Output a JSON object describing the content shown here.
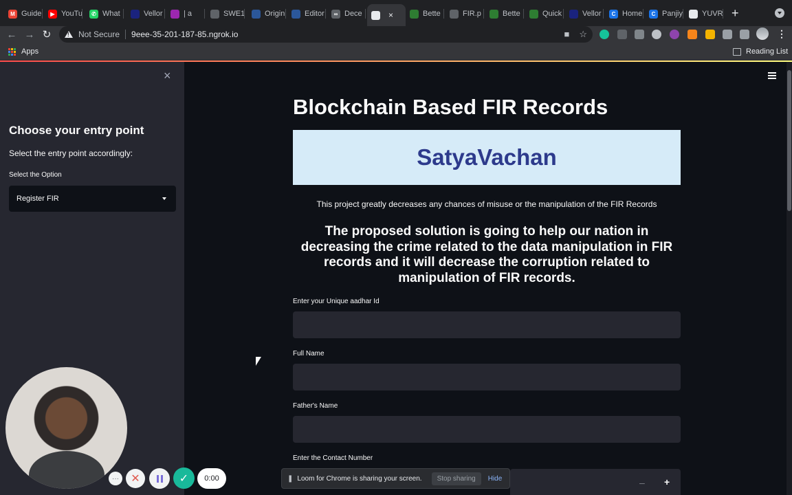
{
  "browser": {
    "tabs": [
      {
        "label": "Guide",
        "fav": "M",
        "color": "#ea4335"
      },
      {
        "label": "YouTu",
        "fav": "▶",
        "color": "#ff0000"
      },
      {
        "label": "What",
        "fav": "✆",
        "color": "#25d366"
      },
      {
        "label": "Vellor",
        "fav": "",
        "color": "#1a237e"
      },
      {
        "label": "| a",
        "fav": "",
        "color": "#9c27b0"
      },
      {
        "label": "SWE1",
        "fav": "",
        "color": "#5f6368"
      },
      {
        "label": "Origin",
        "fav": "",
        "color": "#2b579a"
      },
      {
        "label": "Editor",
        "fav": "",
        "color": "#2b579a"
      },
      {
        "label": "Dece",
        "fav": "∞",
        "color": "#5f6368"
      },
      {
        "label": "",
        "fav": "",
        "color": "#e8eaed"
      },
      {
        "label": "Bette",
        "fav": "",
        "color": "#2e7d32"
      },
      {
        "label": "FIR.p",
        "fav": "",
        "color": "#5f6368"
      },
      {
        "label": "Bette",
        "fav": "",
        "color": "#2e7d32"
      },
      {
        "label": "Quick",
        "fav": "",
        "color": "#2e7d32"
      },
      {
        "label": "Vellor",
        "fav": "",
        "color": "#1a237e"
      },
      {
        "label": "Home",
        "fav": "C",
        "color": "#1a73e8"
      },
      {
        "label": "Panjiy",
        "fav": "C",
        "color": "#1a73e8"
      },
      {
        "label": "YUVR",
        "fav": "",
        "color": "#e8eaed"
      }
    ],
    "new_tab_symbol": "+",
    "not_secure_label": "Not Secure",
    "url": "9eee-35-201-187-85.ngrok.io",
    "bookmarks": {
      "apps_label": "Apps",
      "reading_list_label": "Reading List"
    }
  },
  "sidebar": {
    "close_symbol": "×",
    "heading": "Choose your entry point",
    "subheading": "Select the entry point accordingly:",
    "select_label": "Select the Option",
    "select_value": "Register FIR"
  },
  "main": {
    "title": "Blockchain Based FIR Records",
    "banner_text": "SatyaVachan",
    "description": "This project greatly decreases any chances of misuse or the manipulation of the FIR Records",
    "lead": "The proposed solution is going to help our nation in decreasing the crime related to the data manipulation in FIR records and it will decrease the corruption related to manipulation of FIR records.",
    "fields": [
      {
        "label": "Enter your Unique aadhar Id",
        "value": ""
      },
      {
        "label": "Full Name",
        "value": ""
      },
      {
        "label": "Father's Name",
        "value": ""
      },
      {
        "label": "Enter the Contact Number",
        "value": ""
      }
    ],
    "stepper_minus": "–",
    "stepper_plus": "+"
  },
  "loom": {
    "more_symbol": "···",
    "cancel_symbol": "✕",
    "done_symbol": "✓",
    "timer": "0:00",
    "sharing_text": "Loom for Chrome is sharing your screen.",
    "stop_sharing_label": "Stop sharing",
    "hide_label": "Hide"
  },
  "colors": {
    "page_bg": "#0e1117",
    "sidebar_bg": "#262730",
    "banner_bg": "#d6ebf8",
    "banner_text": "#2d3a8c",
    "accent": "#ff4b4b"
  }
}
